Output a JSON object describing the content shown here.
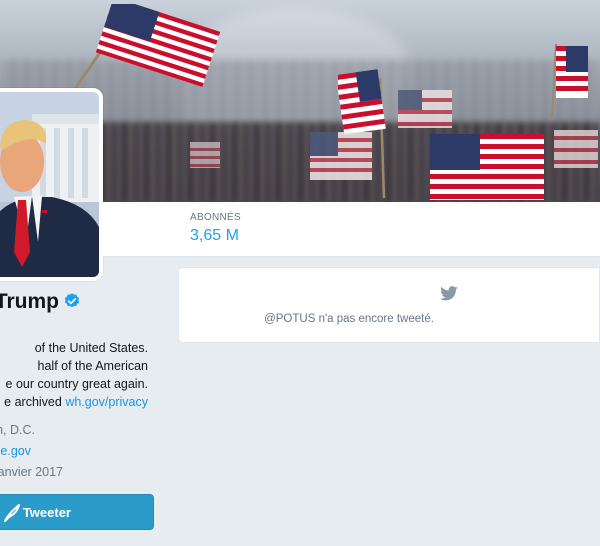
{
  "profile": {
    "name": "t Trump",
    "bio_lines": [
      "of the United States.",
      "half of the American",
      "e our country great again.",
      "e archived "
    ],
    "bio_link": "wh.gov/privacy",
    "location": "n, D.C.",
    "website": "e.gov",
    "joined": "anvier 2017",
    "tweet_button_label": "Tweeter"
  },
  "stats": {
    "followers_label": "ABONNÉS",
    "followers_value": "3,65 M"
  },
  "timeline": {
    "empty_message": "@POTUS n'a pas encore tweeté."
  },
  "colors": {
    "accent": "#1da1f2",
    "link": "#1b95e0",
    "button": "#2b9bc9",
    "background": "#e6ecf0"
  },
  "icons": {
    "verified": "verified-badge-icon",
    "tweet": "quill-icon",
    "bird": "twitter-bird-icon"
  }
}
